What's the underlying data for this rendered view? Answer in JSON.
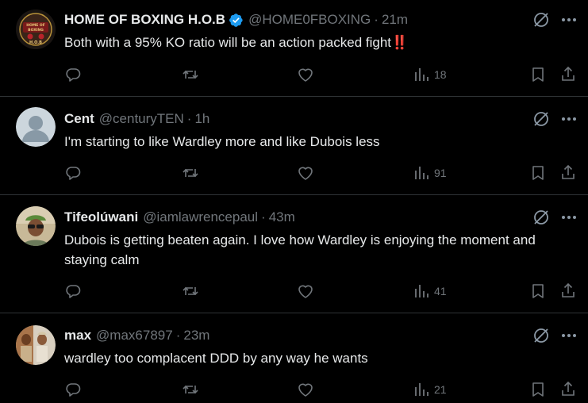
{
  "colors": {
    "background": "#000000",
    "primary_text": "#e7e9ea",
    "secondary_text": "#71767b",
    "divider": "#2f3336",
    "verified_blue": "#1d9bf0"
  },
  "tweets": [
    {
      "name": "HOME OF BOXING H.O.B",
      "verified": true,
      "handle": "@HOME0FBOXING",
      "separator": "·",
      "time": "21m",
      "text": "Both with a 95% KO ratio will be an action packed fight‼️",
      "views": "18",
      "avatar_icon": "hob-logo-avatar",
      "avatar_text": "HOME OF BOXING H.O.B"
    },
    {
      "name": "Cent",
      "verified": false,
      "handle": "@centuryTEN",
      "separator": "·",
      "time": "1h",
      "text": "I'm starting to like Wardley more and like Dubois less",
      "views": "91",
      "avatar_icon": "default-avatar"
    },
    {
      "name": "Tifeolúwani",
      "verified": false,
      "handle": "@iamlawrencepaul",
      "separator": "·",
      "time": "43m",
      "text": "Dubois is getting beaten again. I love how Wardley is enjoying the moment and staying calm",
      "views": "41",
      "avatar_icon": "photo-avatar"
    },
    {
      "name": "max",
      "verified": false,
      "handle": "@max67897",
      "separator": "·",
      "time": "23m",
      "text": "wardley too complacent DDD by any way he wants",
      "views": "21",
      "avatar_icon": "photo-avatar"
    }
  ]
}
